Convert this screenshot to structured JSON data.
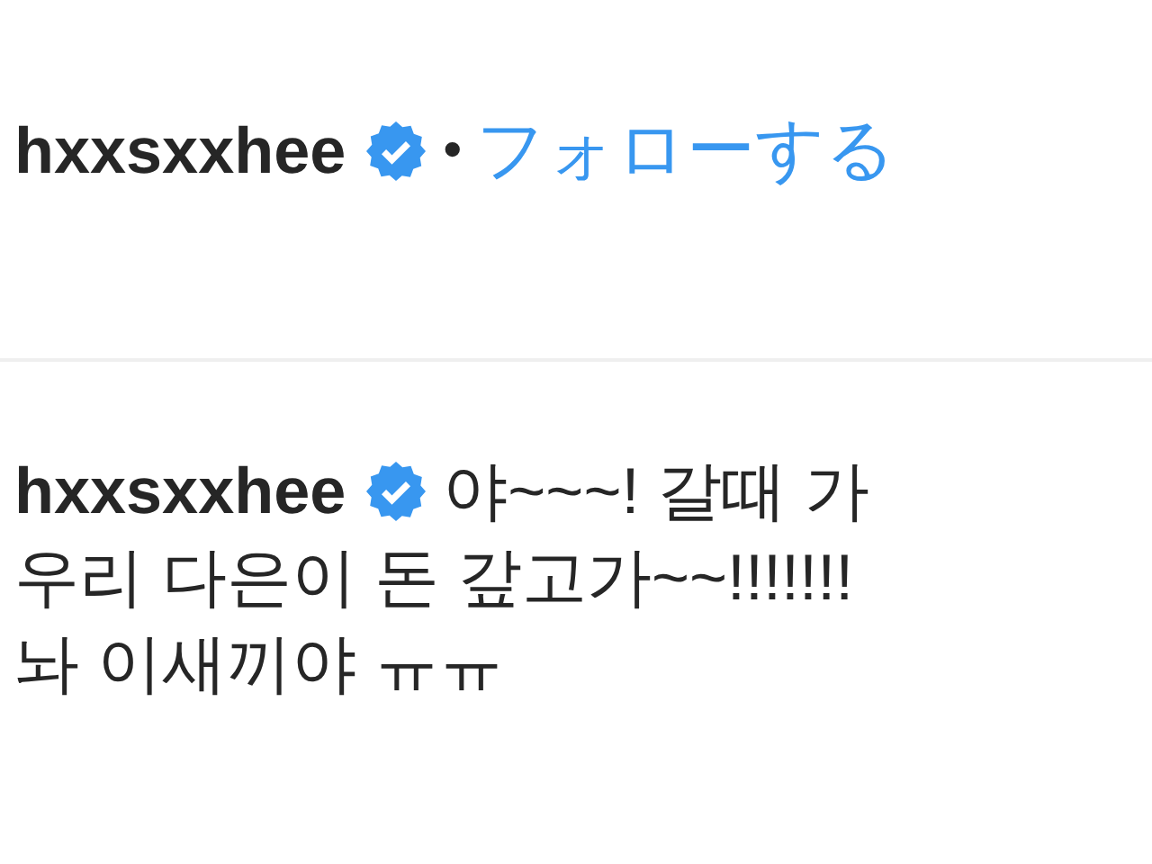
{
  "header": {
    "username": "hxxsxxhee",
    "verified": true,
    "separator": "•",
    "follow": "フォローする"
  },
  "comment": {
    "username": "hxxsxxhee",
    "verified": true,
    "lines": [
      "야~~~! 갈때 가",
      "우리 다은이 돈 갚고가~~!!!!!!!",
      "놔 이새끼야 ㅠㅠ"
    ]
  }
}
